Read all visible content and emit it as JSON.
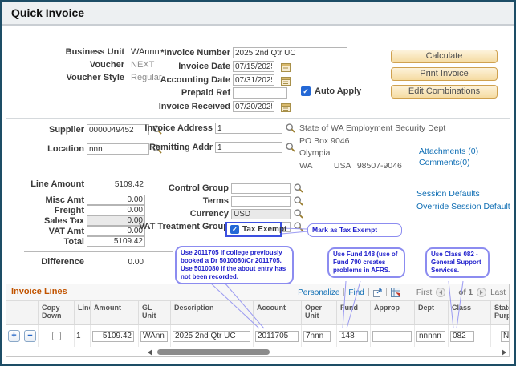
{
  "title": "Quick Invoice",
  "colors": {
    "frame_border": "#1d4d66",
    "button_face": "#f5dba1",
    "button_border": "#cfa14f",
    "link": "#0f6eb4",
    "grid_title": "#c25400",
    "callout_text": "#2121cc",
    "callout_border": "#8c8cf0",
    "checkbox_checked": "#2468d6"
  },
  "icons": {
    "lookup": "magnifier",
    "calendar": "calendar",
    "check": "✓",
    "add": "+",
    "remove": "−",
    "prev": "◀",
    "next": "▶",
    "popout": "popout-window",
    "download": "download-grid"
  },
  "voucher_info": {
    "business_unit_label": "Business Unit",
    "business_unit": "WAnnn",
    "voucher_label": "Voucher",
    "voucher": "NEXT",
    "voucher_style_label": "Voucher Style",
    "voucher_style": "Regular"
  },
  "invoice_header": {
    "invoice_number_label": "*Invoice Number",
    "invoice_number": "2025 2nd Qtr UC",
    "invoice_date_label": "Invoice Date",
    "invoice_date": "07/15/2025",
    "accounting_date_label": "Accounting Date",
    "accounting_date": "07/31/2025",
    "prepaid_ref_label": "Prepaid Ref",
    "prepaid_ref": "",
    "auto_apply_label": "Auto Apply",
    "invoice_received_label": "Invoice Received",
    "invoice_received": "07/20/2025"
  },
  "buttons": {
    "calculate": "Calculate",
    "print_invoice": "Print Invoice",
    "edit_combinations": "Edit Combinations"
  },
  "supplier": {
    "supplier_label": "Supplier",
    "supplier": "0000049452",
    "location_label": "Location",
    "location": "nnn",
    "invoice_address_label": "Invoice Address",
    "invoice_address": "1",
    "remitting_addr_label": "Remitting Addr",
    "remitting_addr": "1",
    "address": {
      "line1": "State of WA Employment Security Dept",
      "line2": "PO Box 9046",
      "line3": "Olympia",
      "state": "WA",
      "country": "USA",
      "postal": "98507-9046"
    },
    "attachments_link": "Attachments (0)",
    "comments_link": "Comments(0)"
  },
  "amounts": {
    "line_amount_label": "Line Amount",
    "line_amount": "5109.42",
    "misc_amt_label": "Misc Amt",
    "misc_amt": "0.00",
    "freight_label": "Freight",
    "freight": "0.00",
    "sales_tax_label": "Sales Tax",
    "sales_tax": "0.00",
    "vat_amt_label": "VAT Amt",
    "vat_amt": "0.00",
    "total_label": "Total",
    "total": "5109.42",
    "difference_label": "Difference",
    "difference": "0.00"
  },
  "misc_fields": {
    "control_group_label": "Control Group",
    "control_group": "",
    "terms_label": "Terms",
    "terms": "",
    "currency_label": "Currency",
    "currency": "USD",
    "vat_treatment_label": "VAT Treatment Group",
    "vat_treatment": "",
    "tax_exempt_label": "Tax Exempt"
  },
  "session_links": {
    "session_defaults": "Session Defaults",
    "override_session_default": "Override Session Default"
  },
  "annotations": {
    "tax_exempt_note": "Mark as Tax Exempt",
    "account_note": "Use 2011705 if college previously booked a Dr 5010080/Cr 2011705. Use 5010080 if the about entry has not been recorded.",
    "fund_note": "Use Fund 148 (use of Fund 790 creates problems in AFRS.",
    "class_note": "Use Class 082 - General Support Services."
  },
  "invoice_lines": {
    "title": "Invoice Lines",
    "toolbar": {
      "personalize": "Personalize",
      "find": "Find",
      "first": "First",
      "range": "of 1",
      "last": "Last"
    },
    "columns": [
      "",
      "",
      "Copy Down",
      "Line",
      "Amount",
      "GL Unit",
      "Description",
      "Account",
      "Oper Unit",
      "Fund",
      "Approp",
      "Dept",
      "Class",
      "State Purpo"
    ],
    "rows": [
      {
        "line": "1",
        "amount": "5109.42",
        "gl_unit": "WAnnn",
        "description": "2025 2nd Qtr UC",
        "account": "2011705",
        "oper_unit": "7nnn",
        "fund": "148",
        "approp": "",
        "dept": "nnnnn",
        "class": "082",
        "state_purpo": "N"
      }
    ]
  }
}
